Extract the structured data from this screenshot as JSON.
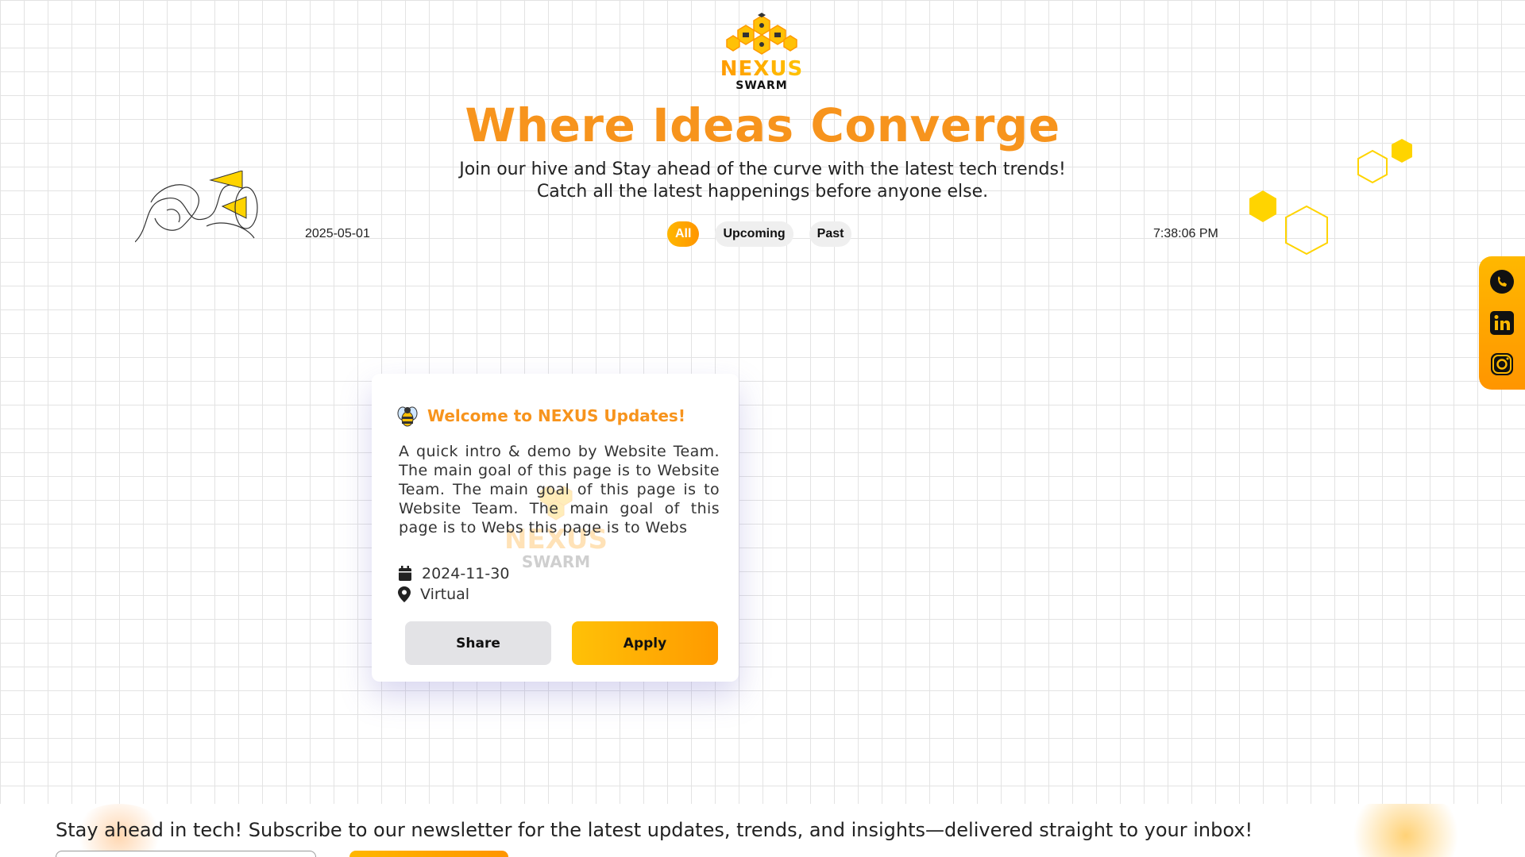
{
  "brand": {
    "logo_text": "NEXUS",
    "logo_sub": "SWARM"
  },
  "hero": {
    "title": "Where Ideas Converge",
    "subtitle_line1": "Join our hive and Stay ahead of the curve with the latest tech trends!",
    "subtitle_line2": "Catch all the latest happenings before anyone else."
  },
  "toolbar": {
    "date": "2025-05-01",
    "time": "7:38:06 PM",
    "filters": [
      {
        "label": "All",
        "active": true
      },
      {
        "label": "Upcoming",
        "active": false
      },
      {
        "label": "Past",
        "active": false
      }
    ]
  },
  "social": {
    "icons": [
      "whatsapp-icon",
      "linkedin-icon",
      "instagram-icon"
    ]
  },
  "event_card": {
    "icon": "bee-icon",
    "title": "Welcome to NEXUS Updates!",
    "description": "A quick intro & demo by Website Team. The main goal of this page is to Website Team. The main goal of this page is to Website Team. The main goal of this page is to Webs this page is to Webs",
    "date": "2024-11-30",
    "location": "Virtual",
    "share_label": "Share",
    "apply_label": "Apply"
  },
  "newsletter": {
    "text": "Stay ahead in tech! Subscribe to our newsletter for the latest updates, trends, and insights—delivered straight to your inbox!"
  },
  "colors": {
    "accent": "#f7941d",
    "yellow": "#ffd400",
    "grid": "#e3e3e3"
  }
}
